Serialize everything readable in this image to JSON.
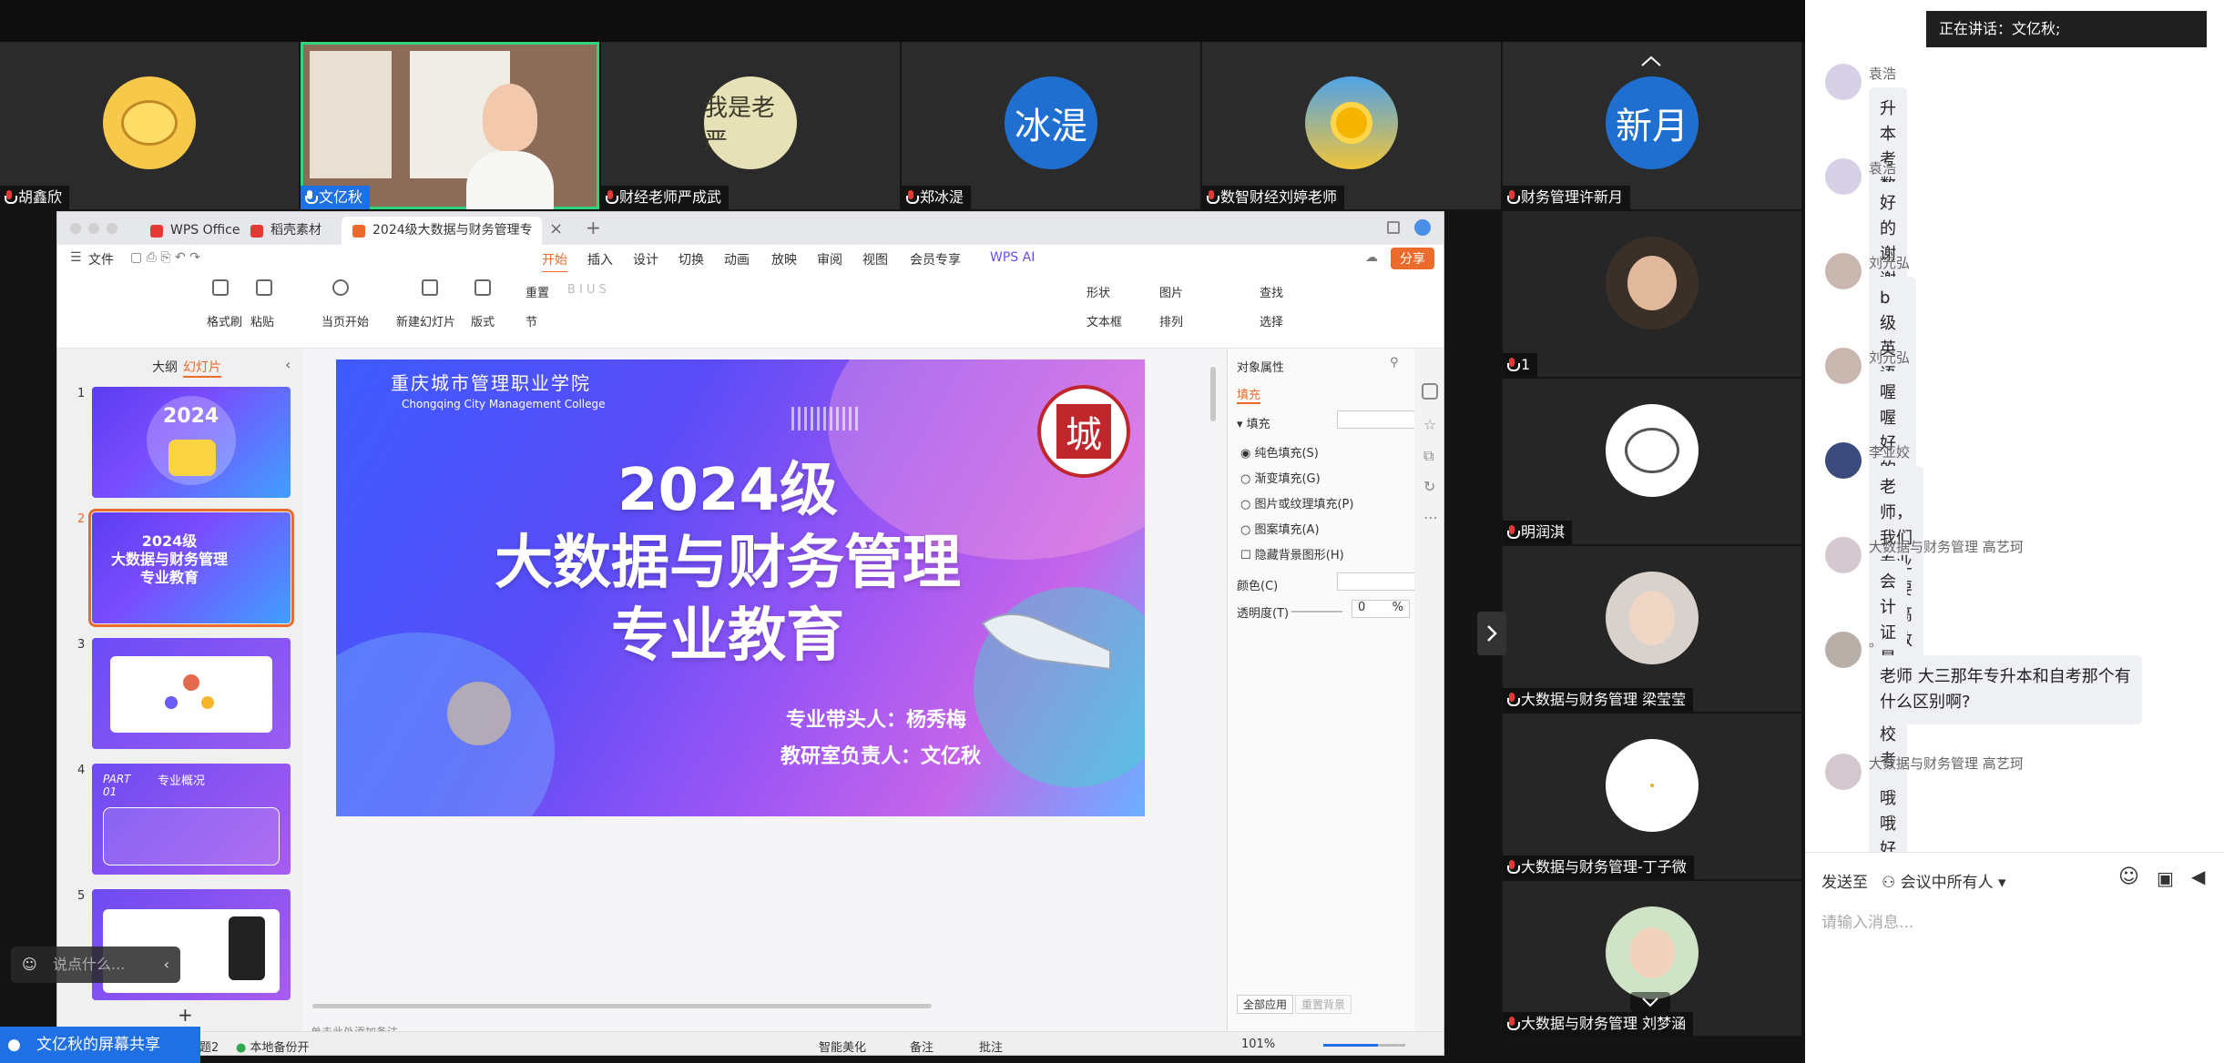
{
  "meeting": {
    "top_participants": [
      {
        "name": "胡鑫欣",
        "color": "#f7c94a"
      },
      {
        "name": "文亿秋",
        "active": true
      },
      {
        "name": "财经老师严成武",
        "avatar_text": "我是老严"
      },
      {
        "name": "郑冰湜",
        "avatar_text": "冰湜",
        "color": "#1f6fd1"
      },
      {
        "name": "数智财经刘婷老师"
      },
      {
        "name": "财务管理许新月",
        "avatar_text": "新月",
        "color": "#1f6fd1"
      }
    ],
    "right_participants": [
      {
        "name": "1"
      },
      {
        "name": "明润淇"
      },
      {
        "name": "大数据与财务管理 梁莹莹"
      },
      {
        "name": "大数据与财务管理-丁子微"
      },
      {
        "name": "大数据与财务管理 刘梦涵"
      }
    ],
    "screen_share_label": "文亿秋的屏幕共享",
    "say_placeholder": "说点什么..."
  },
  "chat": {
    "speaking_label": "正在讲话：文亿秋;",
    "messages": [
      {
        "sender": "袁浩",
        "text": "升本考数学吗"
      },
      {
        "sender": "袁浩",
        "text": "好的谢谢老师"
      },
      {
        "sender": "刘元弘",
        "text": "b级英语是考四六级吗?"
      },
      {
        "sender": "刘元弘",
        "text": "喔喔好的"
      },
      {
        "sender": "李亚姣",
        "text": "老师，我们专业需要学高等数学吗"
      },
      {
        "sender": "大数据与财务管理 高艺珂",
        "text": "会计证是在学校考吗"
      },
      {
        "sender": "。",
        "text": "老师 大三那年专升本和自考那个有什么区别啊?"
      },
      {
        "sender": "大数据与财务管理 高艺珂",
        "text": "哦哦好"
      }
    ],
    "send_to_label": "发送至",
    "send_to_target": "会议中所有人",
    "input_placeholder": "请输入消息..."
  },
  "wps": {
    "tabs": [
      "WPS Office",
      "稻壳素材",
      "2024级大数据与财务管理专"
    ],
    "file_menu": "文件",
    "ribbon_tabs": [
      "开始",
      "插入",
      "设计",
      "切换",
      "动画",
      "放映",
      "审阅",
      "视图",
      "会员专享",
      "WPS AI"
    ],
    "active_ribbon_tab": "开始",
    "share_button": "分享",
    "ribbon_labels": {
      "format_painter": "格式刷",
      "paste": "粘贴",
      "current_start": "当页开始",
      "new_slide": "新建幻灯片",
      "layout": "版式",
      "reset": "重置",
      "section": "节",
      "shape": "形状",
      "image": "图片",
      "textbox": "文本框",
      "arrange": "排列",
      "find": "查找",
      "select": "选择"
    },
    "panel_tabs": [
      "大纲",
      "幻灯片"
    ],
    "slide_numbers": [
      "1",
      "2",
      "3",
      "4",
      "5"
    ],
    "thumb_texts": {
      "t1": "2024",
      "t2_lines": [
        "2024级",
        "大数据与财务管理",
        "专业教育"
      ],
      "t4_part": "PART",
      "t4_num": "01",
      "t4_title": "专业概况"
    },
    "slide": {
      "college_cn": "重庆城市管理职业学院",
      "college_en": "Chongqing City Management College",
      "seal_char": "城",
      "title_lines": [
        "2024级",
        "大数据与财务管理",
        "专业教育"
      ],
      "leader_line": "专业带头人：杨秀梅",
      "director_line": "教研室负责人：文亿秋"
    },
    "props": {
      "title": "对象属性",
      "fill_tab": "填充",
      "fill_section": "填充",
      "options": [
        "纯色填充(S)",
        "渐变填充(G)",
        "图片或纹理填充(P)",
        "图案填充(A)",
        "隐藏背景图形(H)"
      ],
      "color_label": "颜色(C)",
      "transparency_label": "透明度(T)",
      "transparency_value": "0",
      "transparency_unit": "%",
      "apply_all": "全部应用",
      "reset_bg": "重置背景"
    },
    "notes_placeholder": "单击此处添加备注",
    "status": {
      "page": "题2",
      "backup": "本地备份开",
      "beautify": "智能美化",
      "notes": "备注",
      "comment": "批注",
      "zoom": "101%"
    }
  },
  "colors": {
    "accent": "#1f6fe5",
    "active_border": "#2fd37a",
    "wps_orange": "#ea6b2b",
    "slide_title": "#ffffff"
  }
}
